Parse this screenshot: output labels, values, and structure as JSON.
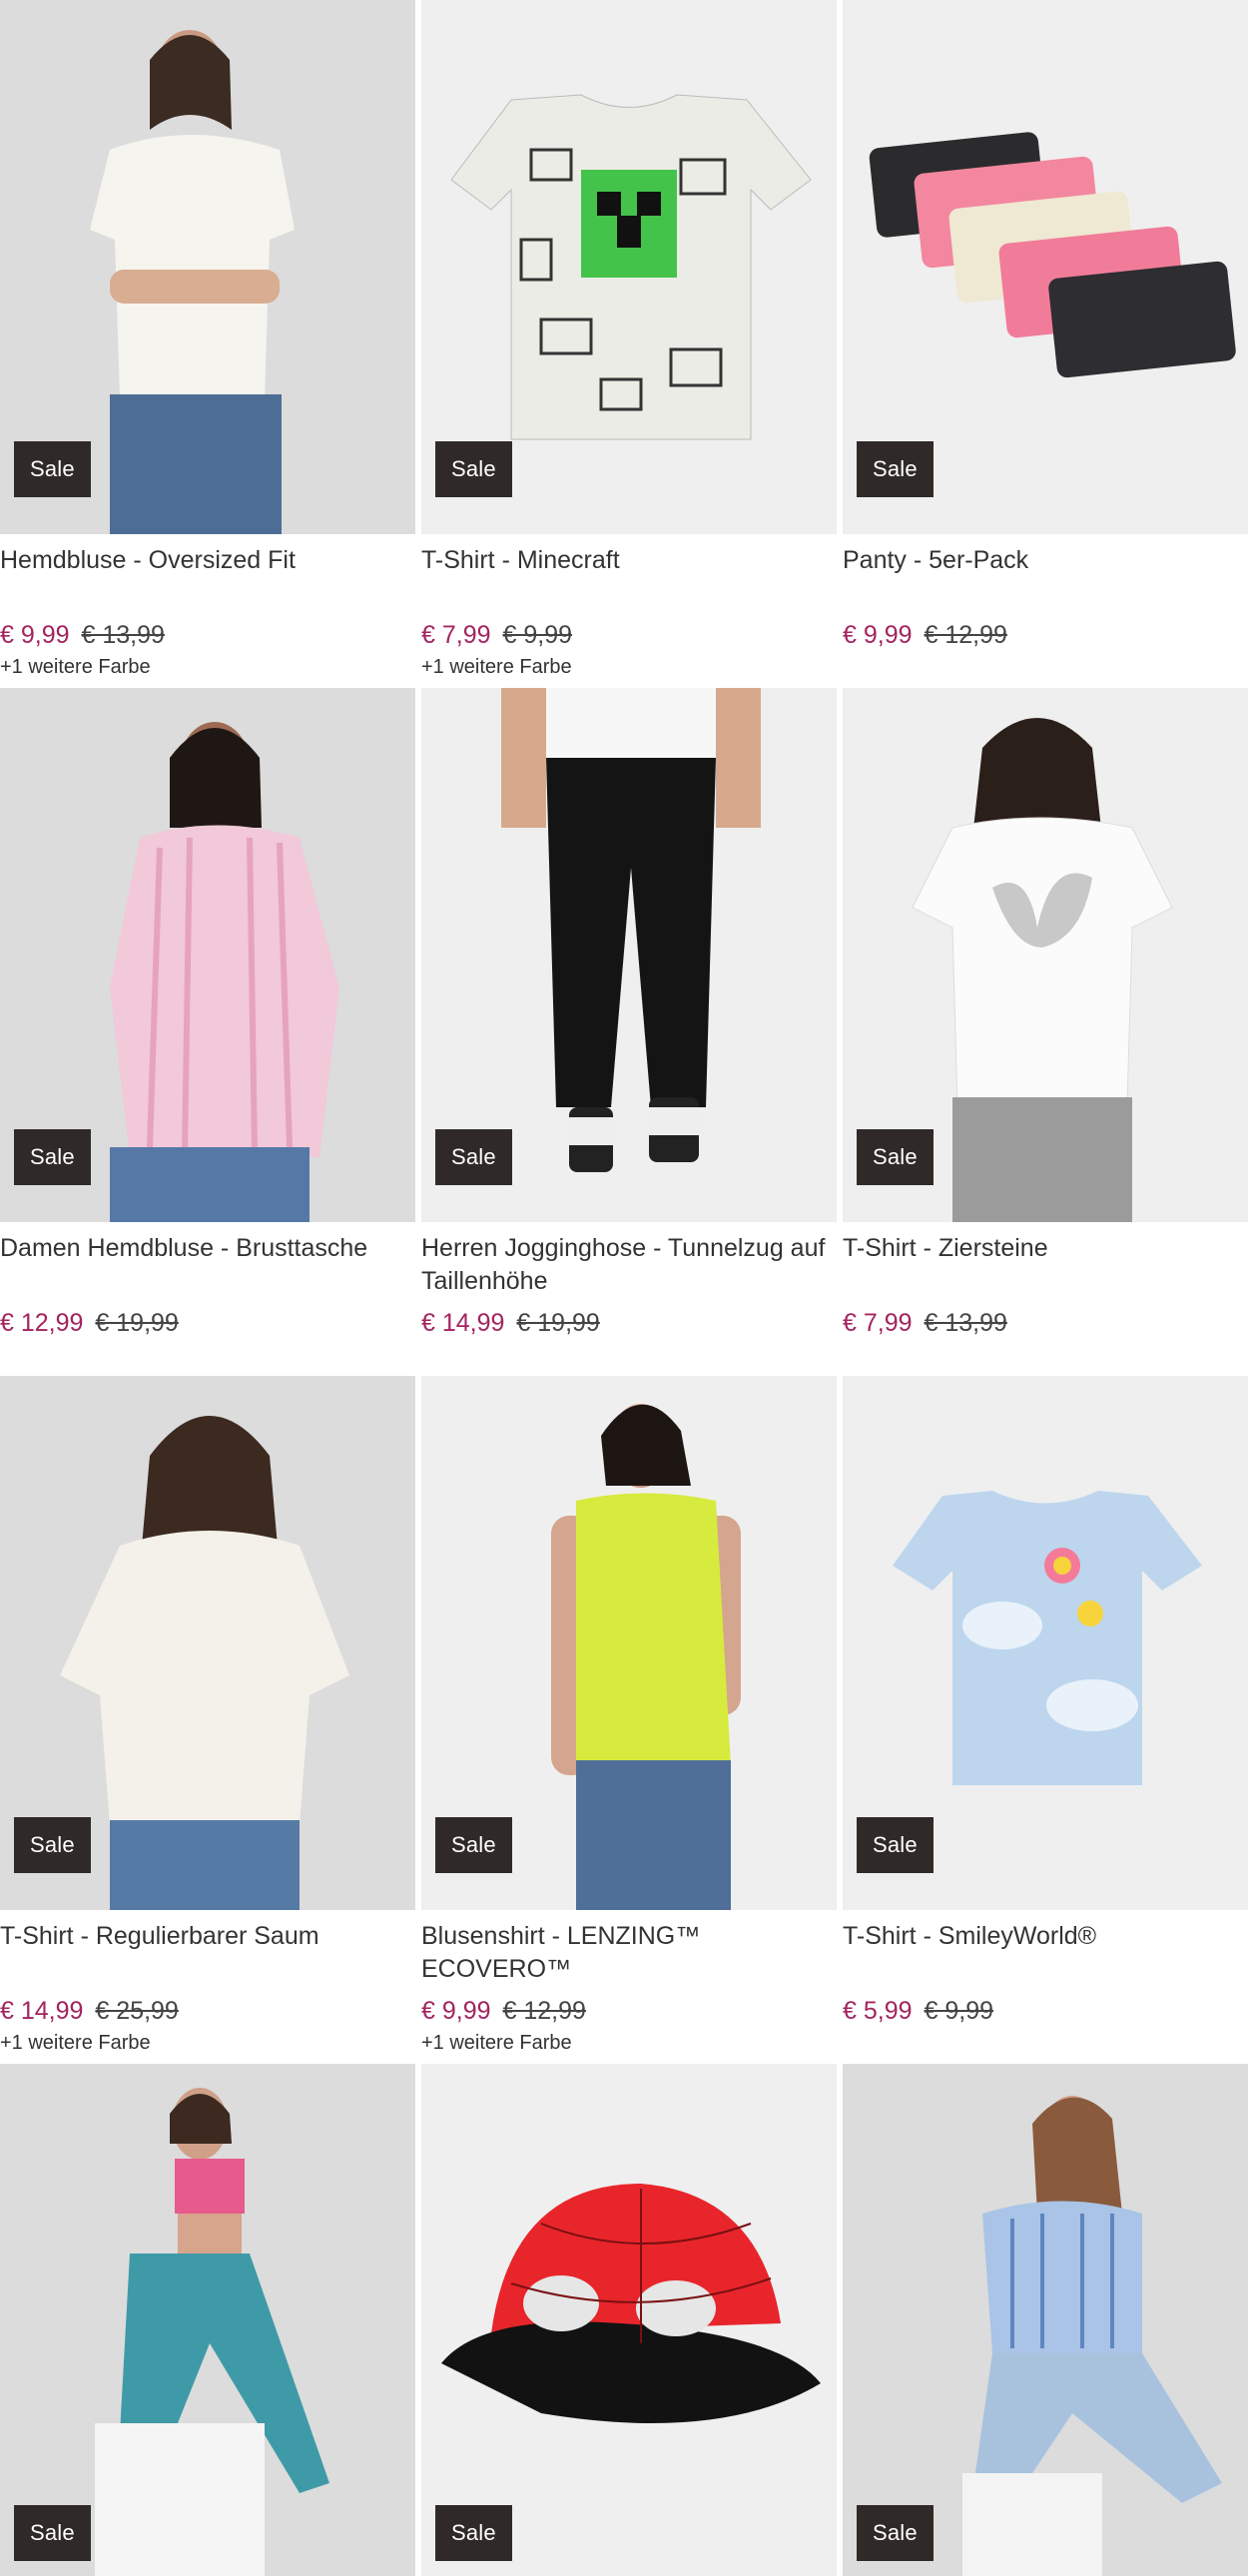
{
  "products": [
    {
      "name": "Hemdbluse - Oversized Fit",
      "badge": "Sale",
      "price": "€ 9,99",
      "old_price": "€ 13,99",
      "more": "+1 weitere Farbe"
    },
    {
      "name": "T-Shirt - Minecraft",
      "badge": "Sale",
      "price": "€ 7,99",
      "old_price": "€ 9,99",
      "more": "+1 weitere Farbe"
    },
    {
      "name": "Panty - 5er-Pack",
      "badge": "Sale",
      "price": "€ 9,99",
      "old_price": "€ 12,99",
      "more": ""
    },
    {
      "name": "Damen Hemdbluse - Brusttasche",
      "badge": "Sale",
      "price": "€ 12,99",
      "old_price": "€ 19,99",
      "more": ""
    },
    {
      "name": "Herren Jogginghose - Tunnelzug auf Taillenhöhe",
      "badge": "Sale",
      "price": "€ 14,99",
      "old_price": "€ 19,99",
      "more": ""
    },
    {
      "name": "T-Shirt - Ziersteine",
      "badge": "Sale",
      "price": "€ 7,99",
      "old_price": "€ 13,99",
      "more": ""
    },
    {
      "name": "T-Shirt - Regulierbarer Saum",
      "badge": "Sale",
      "price": "€ 14,99",
      "old_price": "€ 25,99",
      "more": "+1 weitere Farbe"
    },
    {
      "name": "Blusenshirt - LENZING™ ECOVERO™",
      "badge": "Sale",
      "price": "€ 9,99",
      "old_price": "€ 12,99",
      "more": "+1 weitere Farbe"
    },
    {
      "name": "T-Shirt - SmileyWorld®",
      "badge": "Sale",
      "price": "€ 5,99",
      "old_price": "€ 9,99",
      "more": ""
    },
    {
      "badge": "Sale"
    },
    {
      "badge": "Sale"
    },
    {
      "badge": "Sale"
    }
  ],
  "colors": {
    "sale_price": "#a3245e",
    "badge_bg": "#2f2a28"
  }
}
